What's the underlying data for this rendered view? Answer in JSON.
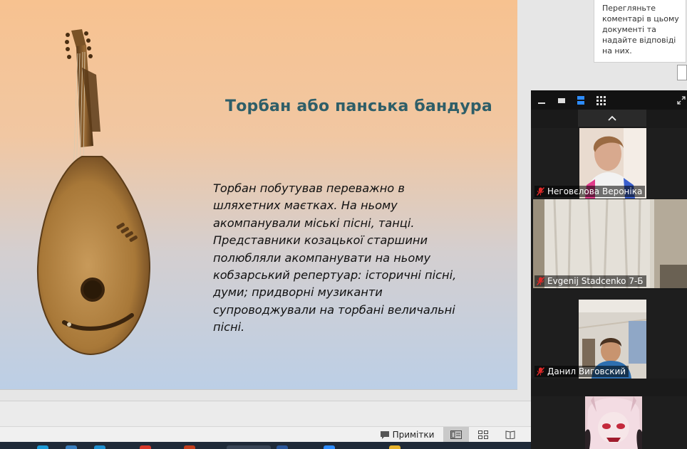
{
  "slide": {
    "title": "Торбан або панська бандура",
    "body": "Торбан побутував переважно в шляхетних маєтках. На ньому акомпанували міські пісні, танці. Представники козацької старшини полюбляли акомпанувати на ньому кобзарський репертуар: історичні пісні, думи; придворні музиканти супроводжували на торбані величальні пісні."
  },
  "status_bar": {
    "notes_label": "Примітки",
    "icons": [
      "comment-icon",
      "normal-view-icon",
      "slide-sorter-icon",
      "reading-view-icon"
    ]
  },
  "comments": {
    "hint_text": "Перегляньте коментарі в цьому документі та надайте відповіді на них."
  },
  "zoom": {
    "toolbar_icons": [
      "minimize-icon",
      "thumbnail-view-icon",
      "speaker-view-icon",
      "gallery-view-icon",
      "fullscreen-icon"
    ],
    "participants": [
      {
        "name": "Неговєлова Вероніка",
        "muted": true
      },
      {
        "name": "Evgenij Stadcenko 7-Б",
        "muted": true
      },
      {
        "name": "Данил Виговский",
        "muted": true
      },
      {
        "name": "",
        "muted": false
      }
    ]
  },
  "colors": {
    "title": "#2e5e68",
    "active_view": "#2d8cff",
    "muted_mic": "#e02828"
  }
}
